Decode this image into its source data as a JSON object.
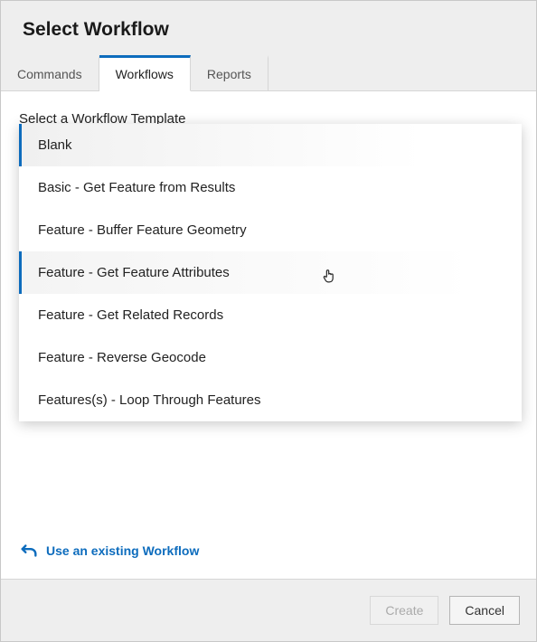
{
  "dialog": {
    "title": "Select Workflow"
  },
  "tabs": [
    {
      "label": "Commands",
      "active": false
    },
    {
      "label": "Workflows",
      "active": true
    },
    {
      "label": "Reports",
      "active": false
    }
  ],
  "section_label": "Select a Workflow Template",
  "dropdown": {
    "items": [
      {
        "label": "Blank",
        "state": "selected"
      },
      {
        "label": "Basic - Get Feature from Results",
        "state": ""
      },
      {
        "label": "Feature - Buffer Feature Geometry",
        "state": ""
      },
      {
        "label": "Feature - Get Feature Attributes",
        "state": "hovered"
      },
      {
        "label": "Feature - Get Related Records",
        "state": ""
      },
      {
        "label": "Feature - Reverse Geocode",
        "state": ""
      },
      {
        "label": "Features(s) - Loop Through Features",
        "state": ""
      }
    ]
  },
  "existing_link": "Use an existing Workflow",
  "buttons": {
    "create": "Create",
    "cancel": "Cancel"
  }
}
